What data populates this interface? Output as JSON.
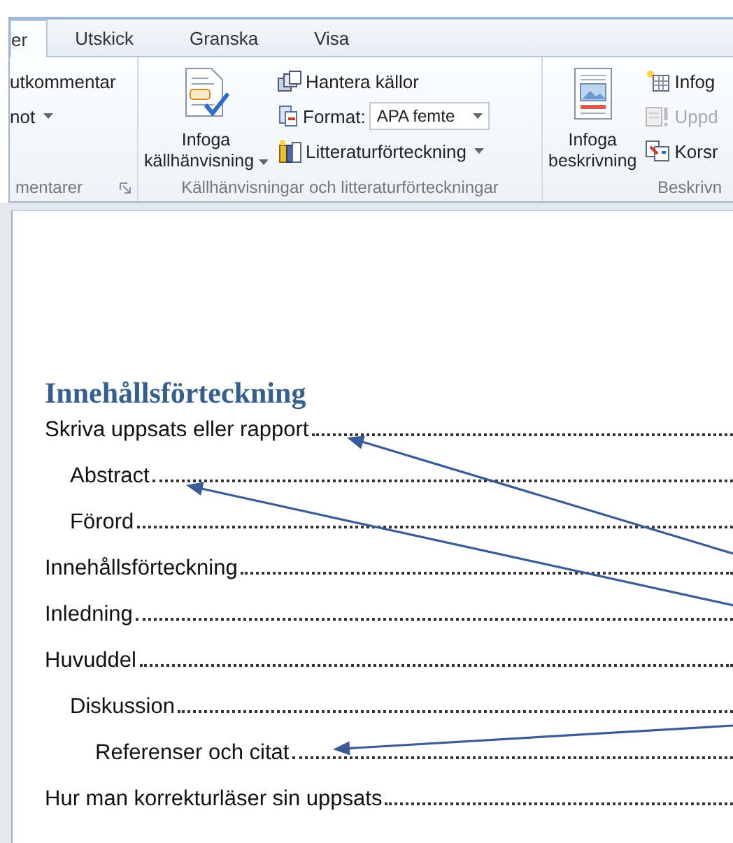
{
  "tabs": [
    {
      "label": "er",
      "selected": true
    },
    {
      "label": "Utskick",
      "selected": false
    },
    {
      "label": "Granska",
      "selected": false
    },
    {
      "label": "Visa",
      "selected": false
    }
  ],
  "ribbon_groups": [
    {
      "label": "mentarer",
      "items": [
        {
          "kind": "text",
          "label": "utkommentar",
          "disabled": false
        },
        {
          "kind": "text",
          "label": "not",
          "disabled": false
        }
      ]
    },
    {
      "label": "Källhänvisningar och litteraturförteckningar",
      "big": {
        "lines": [
          "Infoga",
          "källhänvisning"
        ]
      },
      "items": [
        {
          "kind": "button",
          "label": "Hantera källor",
          "disabled": false
        },
        {
          "kind": "combo",
          "label": "Format:",
          "value": "APA femte",
          "disabled": false
        },
        {
          "kind": "button",
          "label": "Litteraturförteckning",
          "disabled": false
        }
      ]
    },
    {
      "label": "Beskrivn",
      "big": {
        "lines": [
          "Infoga",
          "beskrivning"
        ]
      },
      "items": [
        {
          "kind": "button",
          "label": "Infog",
          "disabled": false
        },
        {
          "kind": "button",
          "label": "Uppd",
          "disabled": true
        },
        {
          "kind": "button",
          "label": "Korsr",
          "disabled": false
        }
      ]
    }
  ],
  "toc": {
    "title": "Innehållsförteckning",
    "entries": [
      {
        "text": "Skriva uppsats eller rapport",
        "children": [
          {
            "text": "Abstract"
          },
          {
            "text": "Förord"
          }
        ]
      },
      {
        "text": "Innehållsförteckning"
      },
      {
        "text": "Inledning"
      },
      {
        "text": "Huvuddel",
        "children": [
          {
            "text": "Diskussion",
            "children": [
              {
                "text": "Referenser och citat"
              }
            ]
          }
        ]
      },
      {
        "text": "Hur man korrekturläser sin uppsats"
      }
    ]
  }
}
